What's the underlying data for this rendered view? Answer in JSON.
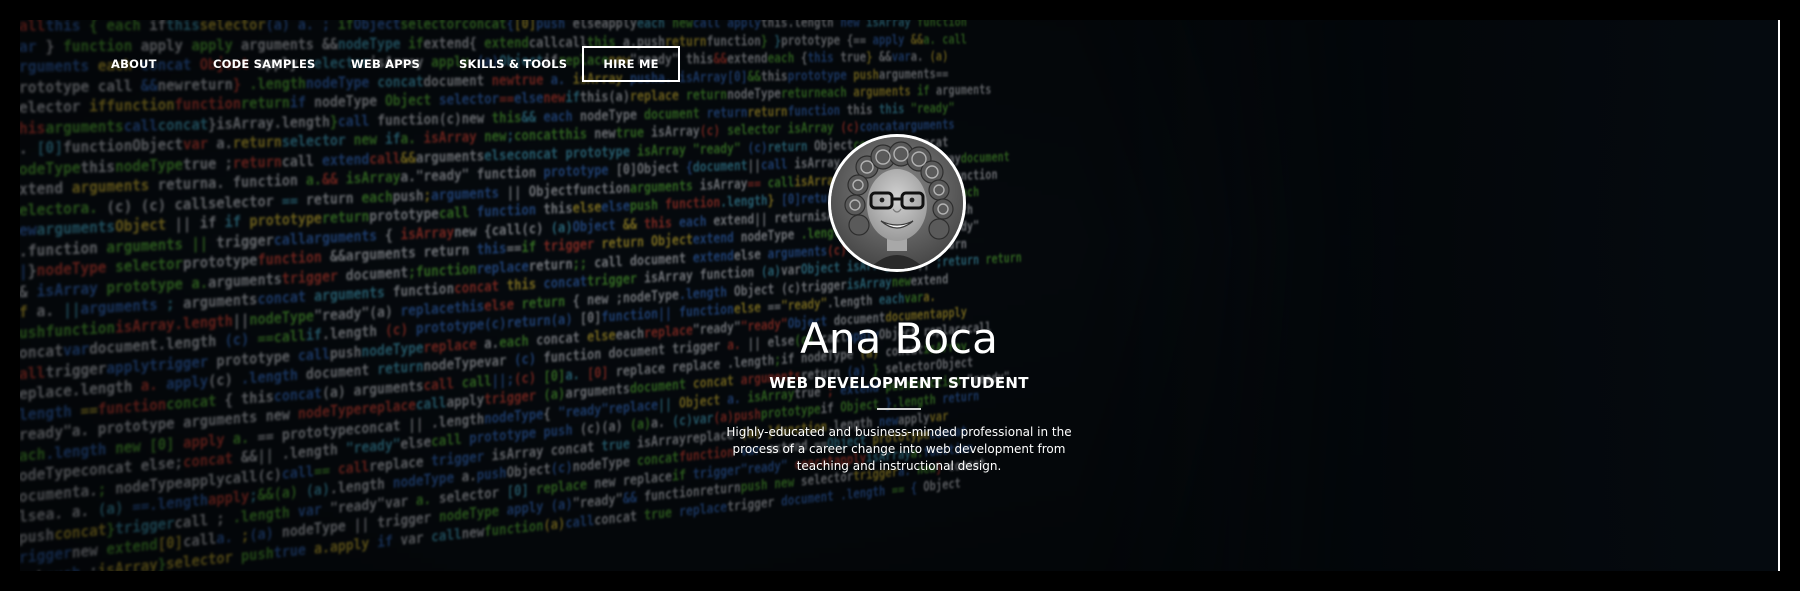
{
  "nav": {
    "items": [
      {
        "label": "ABOUT"
      },
      {
        "label": "CODE SAMPLES"
      },
      {
        "label": "WEB APPS"
      },
      {
        "label": "SKILLS & TOOLS"
      }
    ],
    "cta_label": "HIRE ME"
  },
  "profile": {
    "name": "Ana Boca",
    "title": "WEB DEVELOPMENT STUDENT",
    "description": "Highly-educated and business-minded professional in the process of a career change into web development from teaching and instructional design."
  },
  "colors": {
    "background": "#000000",
    "text": "#ffffff",
    "code_green": "#5fc43f",
    "code_blue": "#3a78d8",
    "code_yellow": "#e2c73a",
    "code_red": "#e0473a"
  },
  "icons": {
    "avatar": "profile-photo"
  }
}
